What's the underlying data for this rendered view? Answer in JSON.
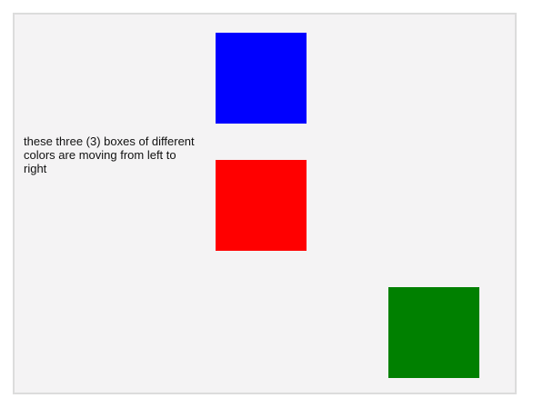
{
  "caption": {
    "text": "these three (3) boxes of different colors are moving from left to right"
  },
  "boxes": [
    {
      "name": "blue-box",
      "color": "#0000ff"
    },
    {
      "name": "red-box",
      "color": "#ff0000"
    },
    {
      "name": "green-box",
      "color": "#008000"
    }
  ],
  "colors": {
    "page_background": "#ffffff",
    "stage_background": "#f4f3f4",
    "stage_border": "#dcdcdc",
    "text": "#111111"
  }
}
